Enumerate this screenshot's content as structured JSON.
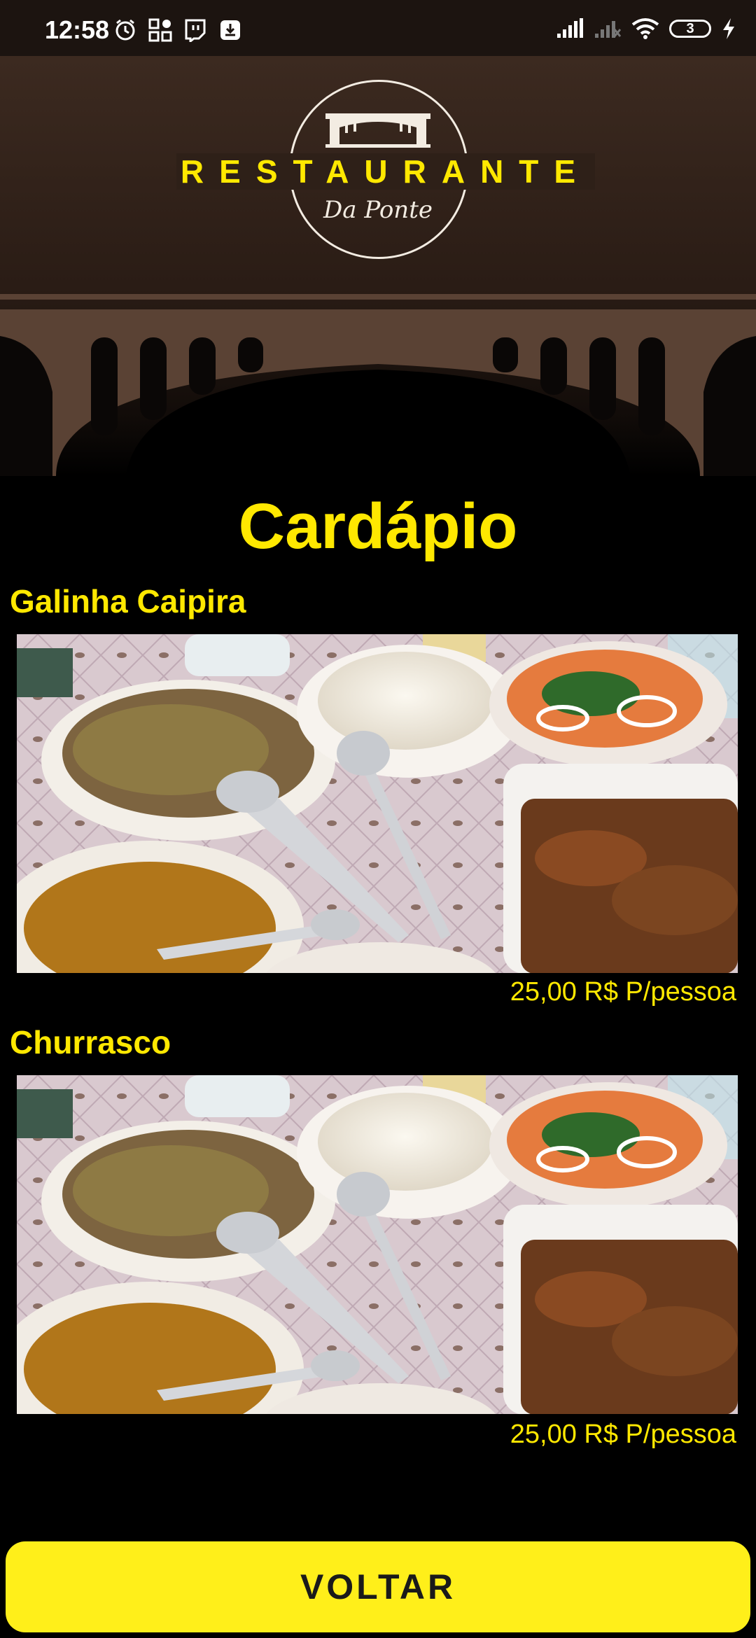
{
  "status_bar": {
    "time": "12:58",
    "battery_level": "3",
    "left_icons": [
      "alarm-icon",
      "qr-app-icon",
      "twitch-icon",
      "download-icon"
    ],
    "right_icons": [
      "signal-icon",
      "signal-no-service-icon",
      "wifi-icon",
      "battery-icon",
      "charging-icon"
    ]
  },
  "header": {
    "logo_title": "RESTAURANTE",
    "logo_subtitle": "Da Ponte"
  },
  "menu": {
    "title": "Cardápio",
    "items": [
      {
        "name": "Galinha Caipira",
        "price": "25,00 R$ P/pessoa"
      },
      {
        "name": "Churrasco",
        "price": "25,00 R$ P/pessoa"
      }
    ]
  },
  "actions": {
    "back_label": "VOLTAR"
  },
  "colors": {
    "accent": "#FFE800",
    "button": "#FFEF1A",
    "header_brown": "#3C2A20",
    "bridge_brown": "#5A4234"
  }
}
